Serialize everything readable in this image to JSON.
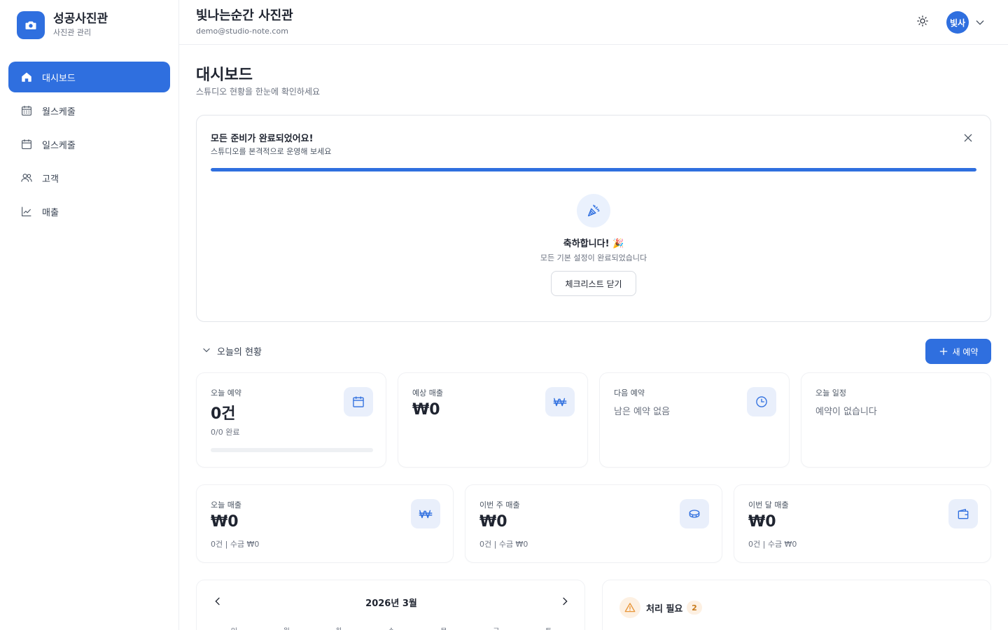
{
  "brand": {
    "name": "성공사진관",
    "subtitle": "사진관 관리"
  },
  "sidebar": {
    "items": [
      {
        "label": "대시보드",
        "icon": "home-icon",
        "active": true
      },
      {
        "label": "월스케줄",
        "icon": "calendar-month-icon",
        "active": false
      },
      {
        "label": "일스케줄",
        "icon": "calendar-day-icon",
        "active": false
      },
      {
        "label": "고객",
        "icon": "users-icon",
        "active": false
      },
      {
        "label": "매출",
        "icon": "chart-line-icon",
        "active": false
      }
    ]
  },
  "header": {
    "studio_name": "빛나는순간 사진관",
    "email": "demo@studio-note.com",
    "avatar_text": "빛사"
  },
  "page": {
    "title": "대시보드",
    "subtitle": "스튜디오 현황을 한눈에 확인하세요"
  },
  "checklist": {
    "title": "모든 준비가 완료되었어요!",
    "subtitle": "스튜디오를 본격적으로 운영해 보세요",
    "progress": 1.0,
    "congrats": "축하합니다! 🎉",
    "congrats_sub": "모든 기본 설정이 완료되었습니다",
    "close_button": "체크리스트 닫기"
  },
  "today": {
    "section_label": "오늘의 현황",
    "new_button": "새 예약",
    "cards": [
      {
        "label": "오늘 예약",
        "value": "0건",
        "foot": "0/0 완료",
        "progress": 0
      },
      {
        "label": "예상 매출",
        "value": "₩0"
      },
      {
        "label": "다음 예약",
        "muted": "남은 예약 없음"
      },
      {
        "label": "오늘 일정",
        "muted": "예약이 없습니다"
      }
    ]
  },
  "sales": {
    "cards": [
      {
        "label": "오늘 매출",
        "value": "₩0",
        "foot": "0건 | 수금 ₩0"
      },
      {
        "label": "이번 주 매출",
        "value": "₩0",
        "foot": "0건 | 수금 ₩0"
      },
      {
        "label": "이번 달 매출",
        "value": "₩0",
        "foot": "0건 | 수금 ₩0"
      }
    ]
  },
  "calendar": {
    "month": "2026년 3월",
    "weekdays": [
      "일",
      "월",
      "화",
      "수",
      "목",
      "금",
      "토"
    ]
  },
  "todo": {
    "title": "처리 필요",
    "count": "2"
  },
  "colors": {
    "accent": "#2f6fdf",
    "warning": "#e8963a",
    "border": "#e2e5ea"
  }
}
